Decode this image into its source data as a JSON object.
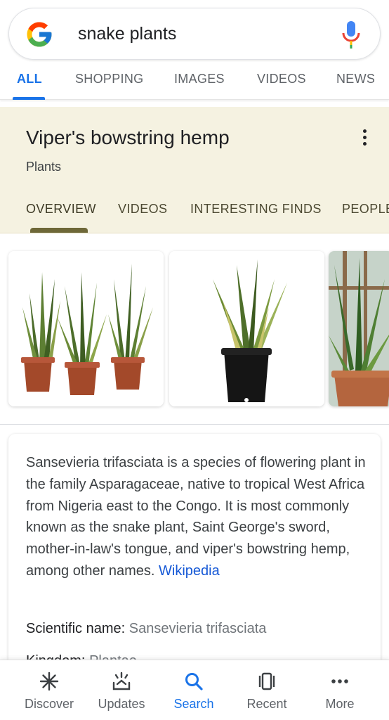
{
  "search": {
    "query": "snake plants",
    "icons": [
      "google-logo-icon",
      "microphone-icon"
    ]
  },
  "top_tabs": [
    {
      "label": "ALL",
      "active": true
    },
    {
      "label": "SHOPPING"
    },
    {
      "label": "IMAGES"
    },
    {
      "label": "VIDEOS"
    },
    {
      "label": "NEWS"
    }
  ],
  "knowledge_panel": {
    "title": "Viper's bowstring hemp",
    "subtitle": "Plants",
    "tabs": [
      {
        "label": "OVERVIEW",
        "active": true
      },
      {
        "label": "VIDEOS"
      },
      {
        "label": "INTERESTING FINDS"
      },
      {
        "label": "PEOPLE"
      }
    ],
    "background": "#f5f2e1"
  },
  "images": [
    {
      "name": "three-potted-snake-plants-image"
    },
    {
      "name": "black-pot-snake-plant-image"
    },
    {
      "name": "terracotta-snake-plant-window-image"
    }
  ],
  "description": {
    "text": "Sansevieria trifasciata is a species of flowering plant in the family Asparagaceae, native to tropical West Africa from Nigeria east to the Congo. It is most commonly known as the snake plant, Saint George's sword, mother-in-law's tongue, and viper's bowstring hemp, among other names.",
    "source": "Wikipedia",
    "scientific_label": "Scientific name:",
    "scientific_value": "Sansevieria trifasciata",
    "kingdom_label": "Kingdom:",
    "kingdom_value": "Plantae"
  },
  "bottom_nav": [
    {
      "label": "Discover",
      "icon": "asterisk-icon"
    },
    {
      "label": "Updates",
      "icon": "updates-icon"
    },
    {
      "label": "Search",
      "icon": "search-icon",
      "active": true
    },
    {
      "label": "Recent",
      "icon": "recent-cards-icon"
    },
    {
      "label": "More",
      "icon": "more-dots-icon"
    }
  ],
  "colors": {
    "accent": "#1a73e8",
    "link": "#1558d6",
    "panel_tab_underline": "#6e6838"
  }
}
